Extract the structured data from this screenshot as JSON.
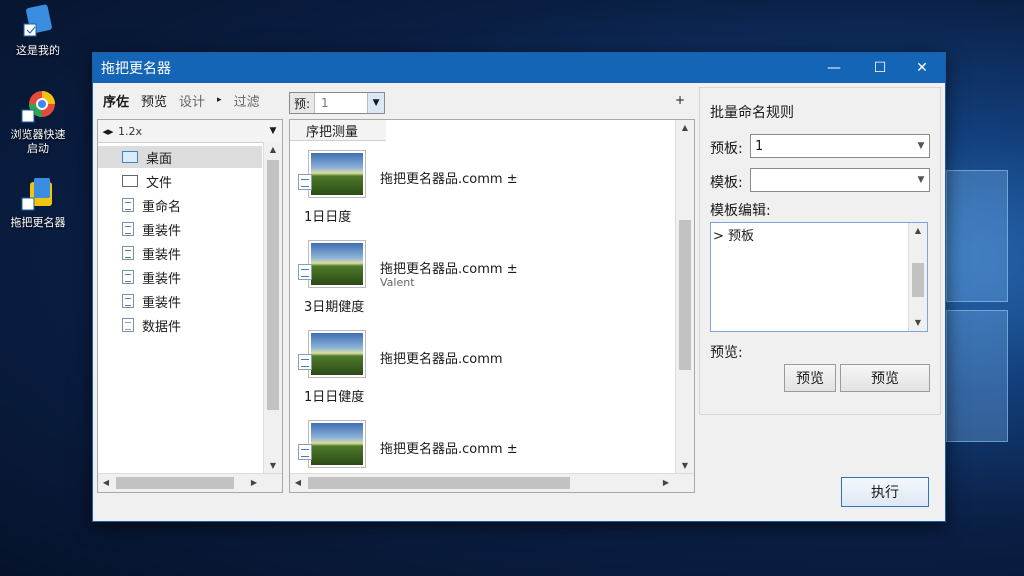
{
  "desktop": {
    "icons": [
      {
        "label": "这是我的"
      },
      {
        "label": "浏览器快速启动"
      },
      {
        "label": "拖把更名器"
      }
    ]
  },
  "window": {
    "title": "拖把更名器",
    "minimize": "—",
    "maximize": "☐",
    "close": "✕"
  },
  "left": {
    "tabs": [
      "序佐",
      "预览",
      "设计",
      "▸",
      "过滤"
    ],
    "path": "1.2x",
    "tree": [
      {
        "label": "桌面",
        "icon": "folder-icon",
        "selected": true
      },
      {
        "label": "文件",
        "icon": "folder-outline-icon"
      },
      {
        "label": "重命名",
        "icon": "document-icon"
      },
      {
        "label": "重装件",
        "icon": "document-icon"
      },
      {
        "label": "重装件",
        "icon": "spreadsheet-icon"
      },
      {
        "label": "重装件",
        "icon": "document-icon"
      },
      {
        "label": "重装件",
        "icon": "document-icon"
      },
      {
        "label": "数据件",
        "icon": "document-icon"
      }
    ]
  },
  "middle": {
    "combo_prefix": "预:",
    "combo_value": "1",
    "add": "+",
    "header": "序把测量",
    "entries": [
      {
        "name": "拖把更名器品.comm ±",
        "sub": "",
        "date": "1日日度"
      },
      {
        "name": "拖把更名器品.comm ±",
        "sub": "Valent",
        "date": "3日期健度"
      },
      {
        "name": "拖把更名器品.comm",
        "sub": "",
        "date": "1日日健度"
      },
      {
        "name": "拖把更名器品.comm ±",
        "sub": "",
        "date": ""
      }
    ]
  },
  "right": {
    "title": "批量命名规则",
    "plus": "+",
    "preset_label": "预板:",
    "preset_value": "1",
    "template_label": "模板:",
    "template_value": "",
    "editor_label": "模板编辑:",
    "editor_text": "> 预板",
    "preview_label": "预览:",
    "btn_preview1": "预览",
    "btn_preview2": "预览"
  },
  "actions": {
    "execute": "执行"
  },
  "colors": {
    "titlebar": "#1565b7",
    "dialog_bg": "#f0f0f0",
    "accent_border": "#2d73c0"
  }
}
